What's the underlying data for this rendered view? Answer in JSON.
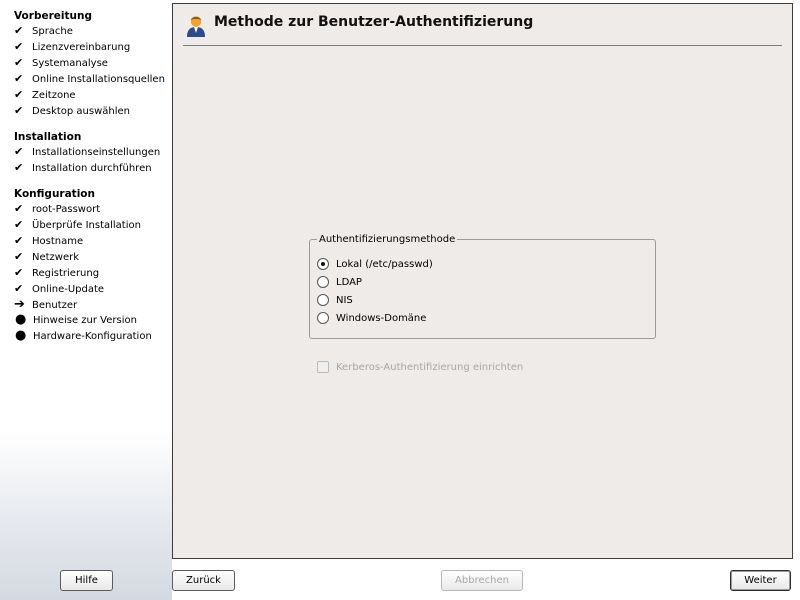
{
  "sidebar": {
    "sections": [
      {
        "title": "Vorbereitung",
        "steps": [
          {
            "label": "Sprache",
            "status": "done"
          },
          {
            "label": "Lizenzvereinbarung",
            "status": "done"
          },
          {
            "label": "Systemanalyse",
            "status": "done"
          },
          {
            "label": "Online Installationsquellen",
            "status": "done"
          },
          {
            "label": "Zeitzone",
            "status": "done"
          },
          {
            "label": "Desktop auswählen",
            "status": "done"
          }
        ]
      },
      {
        "title": "Installation",
        "steps": [
          {
            "label": "Installationseinstellungen",
            "status": "done"
          },
          {
            "label": "Installation durchführen",
            "status": "done"
          }
        ]
      },
      {
        "title": "Konfiguration",
        "steps": [
          {
            "label": "root-Passwort",
            "status": "done"
          },
          {
            "label": "Überprüfe Installation",
            "status": "done"
          },
          {
            "label": "Hostname",
            "status": "done"
          },
          {
            "label": "Netzwerk",
            "status": "done"
          },
          {
            "label": "Registrierung",
            "status": "done"
          },
          {
            "label": "Online-Update",
            "status": "done"
          },
          {
            "label": "Benutzer",
            "status": "current"
          },
          {
            "label": "Hinweise zur Version",
            "status": "pending"
          },
          {
            "label": "Hardware-Konfiguration",
            "status": "pending"
          }
        ]
      }
    ]
  },
  "main": {
    "title": "Methode zur Benutzer-Authentifizierung",
    "title_icon": "user-icon",
    "group_label": "Authentifizierungsmethode",
    "selected_method_index": 0,
    "methods": [
      {
        "label": "Lokal (/etc/passwd)"
      },
      {
        "label": "LDAP"
      },
      {
        "label": "NIS"
      },
      {
        "label": "Windows-Domäne"
      }
    ],
    "kerberos_label": "Kerberos-Authentifizierung einrichten",
    "kerberos_checked": false,
    "kerberos_enabled": false
  },
  "buttons": {
    "help": "Hilfe",
    "back": "Zurück",
    "abort": "Abbrechen",
    "next": "Weiter"
  }
}
